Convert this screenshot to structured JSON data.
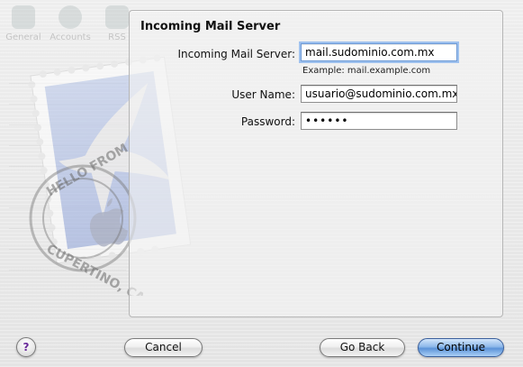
{
  "toolbar_ghost": {
    "items": [
      "General",
      "Accounts",
      "RSS"
    ]
  },
  "panel": {
    "heading": "Incoming Mail Server",
    "incoming_server_label": "Incoming Mail Server:",
    "incoming_server_value": "mail.sudominio.com.mx",
    "incoming_server_hint": "Example: mail.example.com",
    "username_label": "User Name:",
    "username_value": "usuario@sudominio.com.mx",
    "password_label": "Password:",
    "password_value": "••••••"
  },
  "stamp": {
    "text_top": "HELLO FROM",
    "text_bottom": "CUPERTINO, CA"
  },
  "footer": {
    "help_label": "?",
    "cancel_label": "Cancel",
    "back_label": "Go Back",
    "continue_label": "Continue"
  }
}
